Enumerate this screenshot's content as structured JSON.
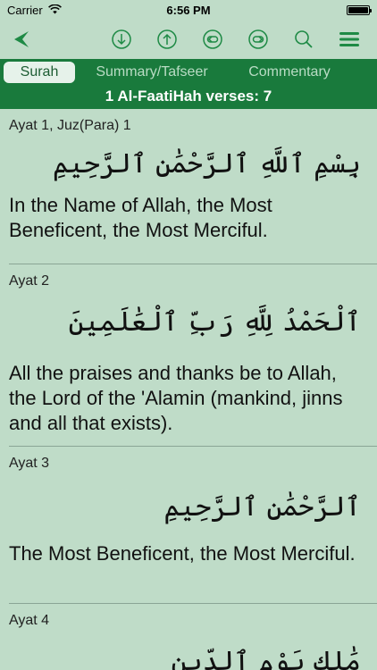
{
  "status": {
    "carrier": "Carrier",
    "time": "6:56 PM"
  },
  "toolbar": {
    "icons": [
      "back-arrow-icon",
      "download-icon",
      "upload-icon",
      "previous-icon",
      "next-icon",
      "search-icon",
      "menu-icon"
    ],
    "color": "#1e8a45"
  },
  "tabs": [
    {
      "label": "Surah",
      "active": true
    },
    {
      "label": "Summary/Tafseer",
      "active": false
    },
    {
      "label": "Commentary",
      "active": false
    }
  ],
  "surah_header": "1 Al-FaatiHah verses: 7",
  "verses": [
    {
      "label": "Ayat 1, Juz(Para) 1",
      "arabic": "بِسْمِ ٱللَّهِ ٱلرَّحْمَٰنِ ٱلرَّحِيمِ",
      "translation": "In the Name of Allah, the Most Beneficent, the Most Merciful."
    },
    {
      "label": "Ayat 2",
      "arabic": "ٱلْحَمْدُ لِلَّهِ رَبِّ ٱلْعَٰلَمِينَ",
      "translation": "All the praises and thanks be to Allah, the Lord of the 'Alamin (mankind, jinns and all that exists)."
    },
    {
      "label": "Ayat 3",
      "arabic": "ٱلرَّحْمَٰنِ ٱلرَّحِيمِ",
      "translation": "The Most Beneficent, the Most Merciful."
    },
    {
      "label": "Ayat 4",
      "arabic": "مَٰلِكِ يَوْمِ ٱلدِّينِ",
      "translation": ""
    }
  ],
  "colors": {
    "background": "#bfdcc8",
    "green": "#197a3c",
    "icon": "#1e8a45"
  }
}
